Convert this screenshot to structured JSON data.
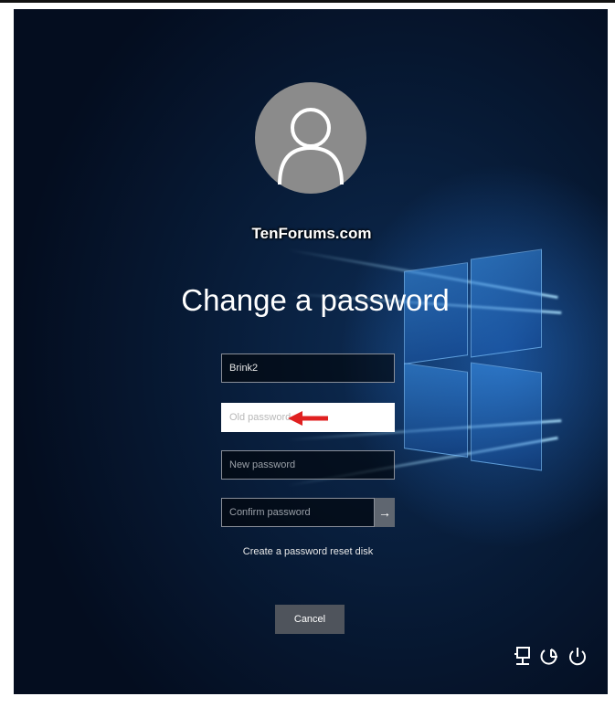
{
  "watermark": "TenForums.com",
  "title": "Change a password",
  "fields": {
    "username_value": "Brink2",
    "old_password_placeholder": "Old password",
    "new_password_placeholder": "New password",
    "confirm_password_placeholder": "Confirm password"
  },
  "submit_glyph": "→",
  "reset_link": "Create a password reset disk",
  "cancel_label": "Cancel",
  "system_icons": [
    "network-icon",
    "ease-of-access-icon",
    "power-icon"
  ],
  "colors": {
    "background": "#071a35",
    "avatar": "#8b8b8b",
    "arrow_annotation": "#e02020"
  }
}
